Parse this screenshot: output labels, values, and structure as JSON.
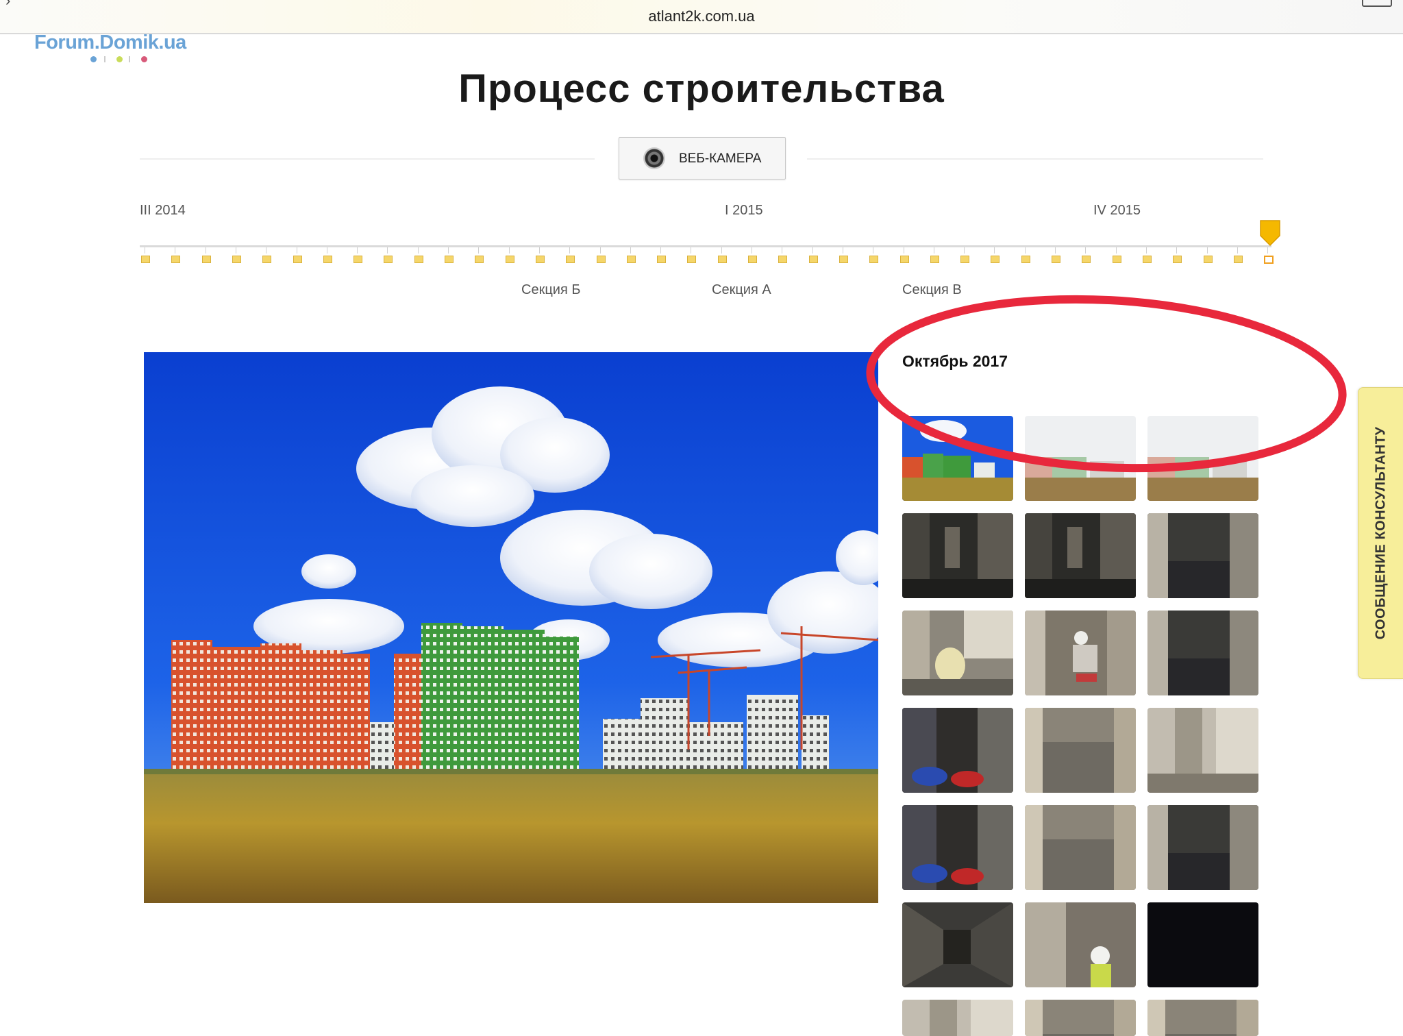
{
  "browser": {
    "url": "atlant2k.com.ua"
  },
  "logo": {
    "text": "Forum.Domik.ua"
  },
  "page": {
    "title": "Процесс строительства"
  },
  "webcam_button": {
    "label": "ВЕБ-КАМЕРА",
    "icon": "camera-icon"
  },
  "timeline": {
    "year_labels": [
      "III 2014",
      "I 2015",
      "IV 2015"
    ],
    "section_labels": [
      "Секция Б",
      "Секция А",
      "Секция В"
    ],
    "point_count": 38,
    "active_point": 37,
    "marker_color": "#f5b800"
  },
  "gallery": {
    "month": "Октябрь 2017",
    "thumb_count": 21
  },
  "consult_tab": {
    "label": "СООБЩЕНИЕ КОНСУЛЬТАНТУ"
  },
  "colors": {
    "logo": "#6aa3d6",
    "timeline_dot": "#f5d66a",
    "annotation": "#e8283c",
    "consult_bg": "#f7ee9a"
  }
}
